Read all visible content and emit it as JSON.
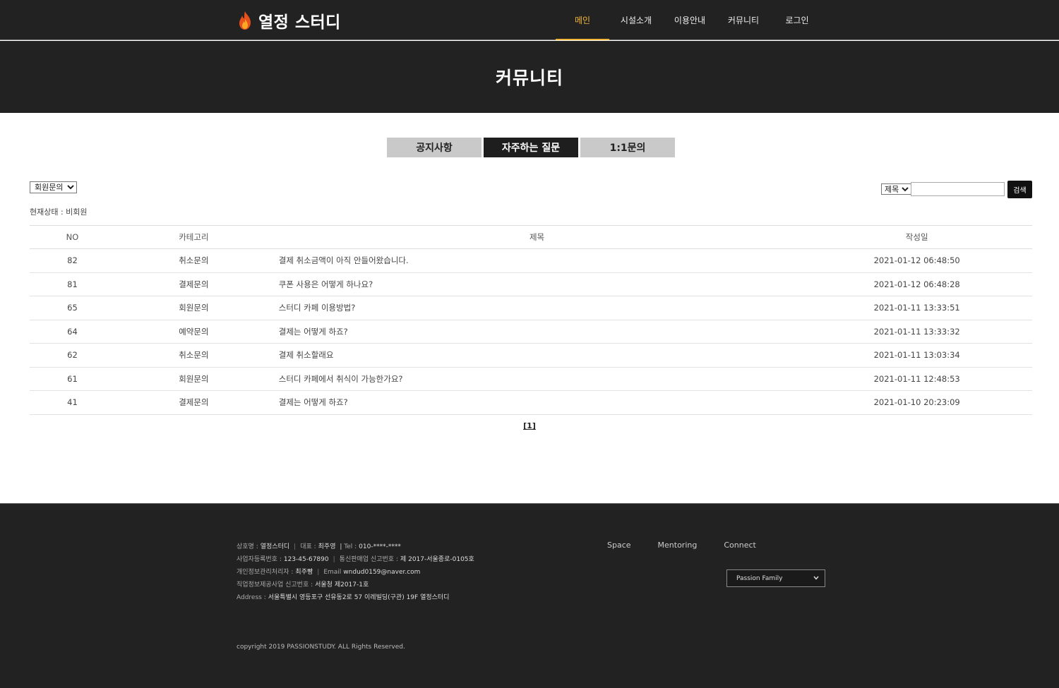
{
  "header": {
    "logo_text": "열정 스터디",
    "nav": [
      "메인",
      "시설소개",
      "이용안내",
      "커뮤니티",
      "로그인"
    ]
  },
  "banner": {
    "title": "커뮤니티"
  },
  "tabs": [
    "공지사항",
    "자주하는 질문",
    "1:1문의"
  ],
  "filter": {
    "category": "회원문의"
  },
  "status": "현재상태 : 비회원",
  "search": {
    "type": "제목",
    "value": "",
    "button": "검색"
  },
  "table": {
    "headers": [
      "NO",
      "카테고리",
      "제목",
      "작성일"
    ],
    "rows": [
      {
        "no": "82",
        "category": "취소문의",
        "title": "결제 취소금액이 아직 안들어왔습니다.",
        "date": "2021-01-12 06:48:50"
      },
      {
        "no": "81",
        "category": "결제문의",
        "title": "쿠폰 사용은 어떻게 하나요?",
        "date": "2021-01-12 06:48:28"
      },
      {
        "no": "65",
        "category": "회원문의",
        "title": "스터디 카페 이용방법?",
        "date": "2021-01-11 13:33:51"
      },
      {
        "no": "64",
        "category": "예약문의",
        "title": "결제는 어떻게 하죠?",
        "date": "2021-01-11 13:33:32"
      },
      {
        "no": "62",
        "category": "취소문의",
        "title": "결제 취소할래요",
        "date": "2021-01-11 13:03:34"
      },
      {
        "no": "61",
        "category": "회원문의",
        "title": "스터디 카페에서 취식이 가능한가요?",
        "date": "2021-01-11 12:48:53"
      },
      {
        "no": "41",
        "category": "결제문의",
        "title": "결제는 어떻게 하죠?",
        "date": "2021-01-10 20:23:09"
      }
    ]
  },
  "pagination": "[1]",
  "footer": {
    "line1": {
      "k1": "상호명 :",
      "v1": "열정스터디",
      "k2": "대표 :",
      "v2": "최주영",
      "k3": "Tel :",
      "v3": "010-****-****"
    },
    "line2": {
      "k1": "사업자등록번호 :",
      "v1": "123-45-67890",
      "k2": "통신판매업 신고번호 :",
      "v2": "제 2017-서울종로-0105호"
    },
    "line3": {
      "k1": "개인정보관리처리자 :",
      "v1": "최주빵",
      "k2": "Email",
      "v2": "wndud0159@naver.com"
    },
    "line4": {
      "k1": "직업정보제공사업 신고번호 :",
      "v1": "서울청 제2017-1호"
    },
    "line5": {
      "k1": "Address :",
      "v1": "서울특별시 영등포구 선유동2로 57 이레빌딩(구관) 19F 열정스터디"
    },
    "links": [
      "Space",
      "Mentoring",
      "Connect"
    ],
    "family_site": "Passion Family",
    "copyright": "copyright 2019 PASSIONSTUDY. ALL Rights Reserved."
  },
  "colors": {
    "accent": "#f2b63a",
    "dark": "#222222",
    "tab_inactive": "#c9c9c9"
  }
}
